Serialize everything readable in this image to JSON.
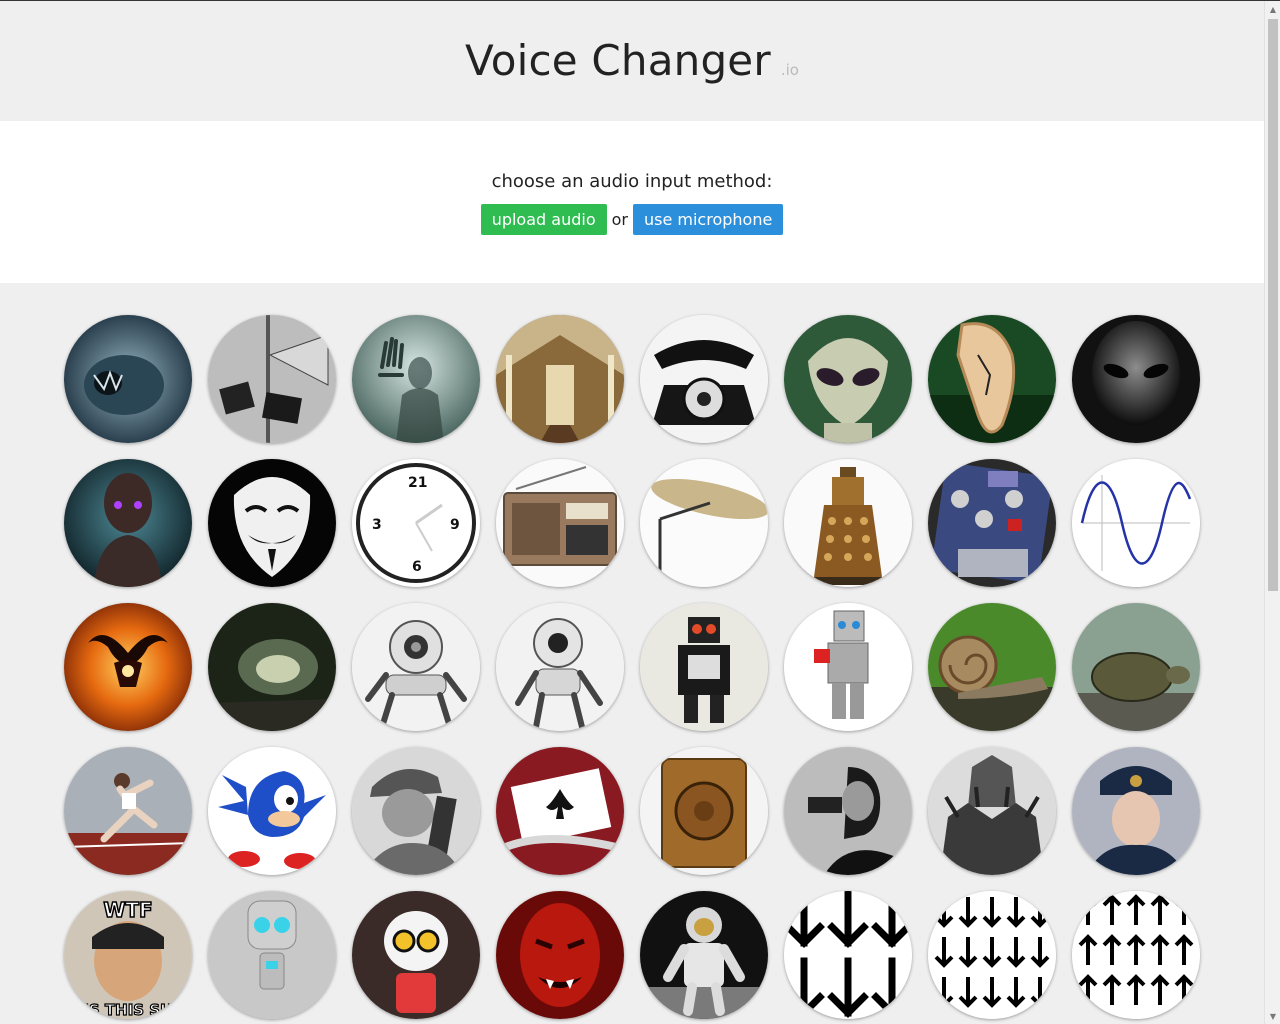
{
  "header": {
    "title": "Voice Changer",
    "suffix": ".io"
  },
  "input": {
    "prompt": "choose an audio input method:",
    "upload_label": "upload audio",
    "or_label": "or",
    "mic_label": "use microphone"
  },
  "colors": {
    "upload": "#2fbd52",
    "microphone": "#2b8fdc",
    "background": "#efefef"
  },
  "voices": [
    {
      "icon": "cave-monster-icon"
    },
    {
      "icon": "megaphone-speakers-icon"
    },
    {
      "icon": "ghost-icon"
    },
    {
      "icon": "cathedral-icon"
    },
    {
      "icon": "telephone-icon"
    },
    {
      "icon": "alien-icon"
    },
    {
      "icon": "melting-clock-icon"
    },
    {
      "icon": "grey-alien-icon"
    },
    {
      "icon": "cyborg-icon"
    },
    {
      "icon": "anonymous-mask-icon"
    },
    {
      "icon": "reversed-clock-icon"
    },
    {
      "icon": "radio-icon"
    },
    {
      "icon": "cymbal-icon"
    },
    {
      "icon": "dalek-icon"
    },
    {
      "icon": "mutron-pedal-icon"
    },
    {
      "icon": "sine-wave-icon"
    },
    {
      "icon": "balrog-icon"
    },
    {
      "icon": "cave-icon"
    },
    {
      "icon": "robot-one-eye-icon"
    },
    {
      "icon": "robot-big-eye-icon"
    },
    {
      "icon": "toy-robot-icon"
    },
    {
      "icon": "lego-robot-icon"
    },
    {
      "icon": "snail-icon"
    },
    {
      "icon": "tortoise-icon"
    },
    {
      "icon": "sprinter-icon"
    },
    {
      "icon": "sonic-icon"
    },
    {
      "icon": "radio-soldier-icon"
    },
    {
      "icon": "playing-cards-icon"
    },
    {
      "icon": "wooden-speaker-icon"
    },
    {
      "icon": "inventor-icon"
    },
    {
      "icon": "dark-knight-icon"
    },
    {
      "icon": "russian-soldier-icon"
    },
    {
      "icon": "wtf-meme-icon",
      "caption_top": "WTF",
      "caption_bottom": "IS THIS SH"
    },
    {
      "icon": "gir-robot-icon"
    },
    {
      "icon": "kirobo-robot-icon"
    },
    {
      "icon": "devil-icon"
    },
    {
      "icon": "astronaut-icon"
    },
    {
      "icon": "arrows-down-large-icon"
    },
    {
      "icon": "arrows-down-small-icon"
    },
    {
      "icon": "arrows-up-small-icon"
    }
  ]
}
